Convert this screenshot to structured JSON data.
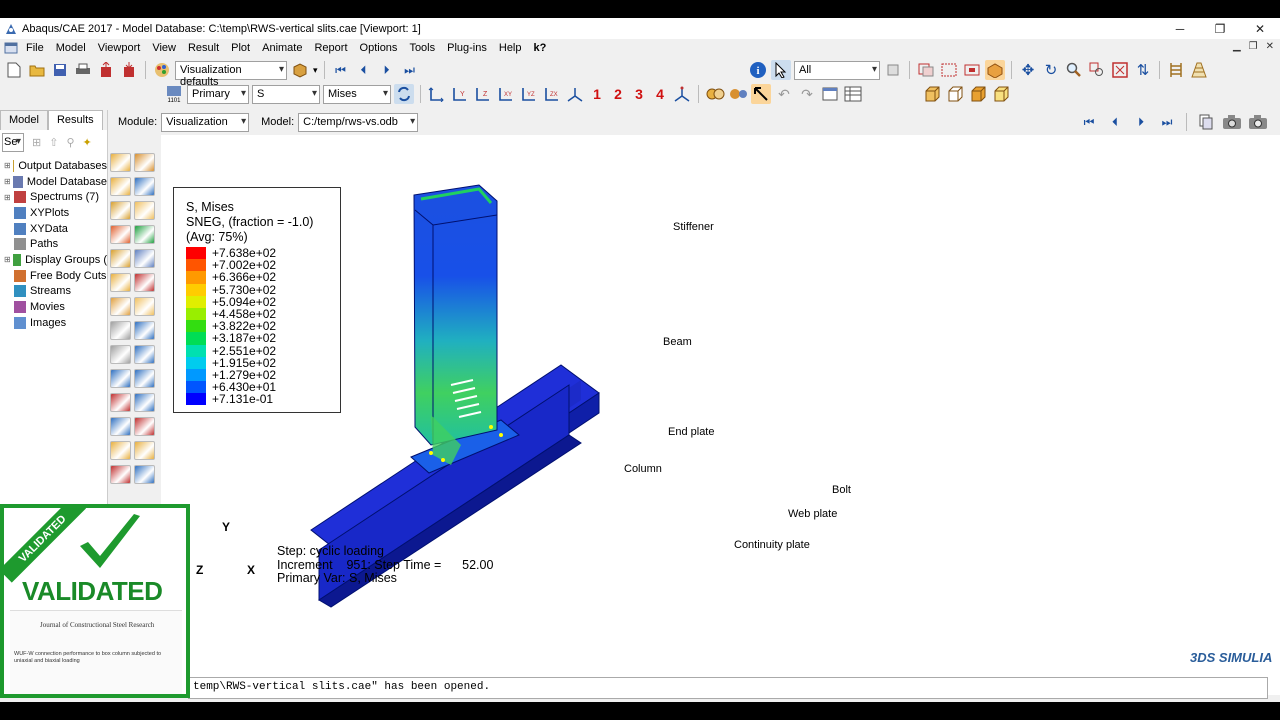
{
  "window": {
    "title": "Abaqus/CAE 2017 - Model Database: C:\\temp\\RWS-vertical slits.cae [Viewport: 1]",
    "controls": [
      "─",
      "❐",
      "✕"
    ]
  },
  "menu": {
    "items": [
      "File",
      "Model",
      "Viewport",
      "View",
      "Result",
      "Plot",
      "Animate",
      "Report",
      "Options",
      "Tools",
      "Plug-ins",
      "Help",
      "k?"
    ]
  },
  "toolbar1": {
    "visualization_defaults": "Visualization defaults",
    "selection_filter": "All"
  },
  "toolbar2": {
    "primary": "Primary",
    "variable": "S",
    "invariant": "Mises",
    "numbers": [
      "1",
      "2",
      "3",
      "4"
    ]
  },
  "module_row": {
    "module_label": "Module:",
    "module_value": "Visualization",
    "model_label": "Model:",
    "model_value": "C:/temp/rws-vs.odb"
  },
  "left_panel": {
    "tabs": [
      "Model",
      "Results"
    ],
    "active_tab": "Results",
    "filter_value": "Se",
    "tree": [
      {
        "label": "Output Databases",
        "expander": "+",
        "color": "#c8a030"
      },
      {
        "label": "Model Database",
        "expander": "+",
        "color": "#6a7ab0"
      },
      {
        "label": "Spectrums (7)",
        "expander": "+",
        "color": "#c04040"
      },
      {
        "label": "XYPlots",
        "expander": "",
        "color": "#5080c0"
      },
      {
        "label": "XYData",
        "expander": "",
        "color": "#5080c0"
      },
      {
        "label": "Paths",
        "expander": "",
        "color": "#909090"
      },
      {
        "label": "Display Groups (",
        "expander": "+",
        "color": "#40a040"
      },
      {
        "label": "Free Body Cuts",
        "expander": "",
        "color": "#d07030"
      },
      {
        "label": "Streams",
        "expander": "",
        "color": "#3090c0"
      },
      {
        "label": "Movies",
        "expander": "",
        "color": "#a050a0"
      },
      {
        "label": "Images",
        "expander": "",
        "color": "#6090d0"
      }
    ]
  },
  "legend": {
    "title_lines": [
      "S, Mises",
      "SNEG, (fraction = -1.0)",
      "(Avg: 75%)"
    ],
    "values": [
      "+7.638e+02",
      "+7.002e+02",
      "+6.366e+02",
      "+5.730e+02",
      "+5.094e+02",
      "+4.458e+02",
      "+3.822e+02",
      "+3.187e+02",
      "+2.551e+02",
      "+1.915e+02",
      "+1.279e+02",
      "+6.430e+01",
      "+7.131e-01"
    ],
    "colors": [
      "#ff0000",
      "#ff5500",
      "#ff9900",
      "#ffcc00",
      "#e0ee00",
      "#99ee00",
      "#33dd11",
      "#00dd55",
      "#00e0b0",
      "#00ccee",
      "#0099ff",
      "#0055ff",
      "#0000ff"
    ]
  },
  "step_info": {
    "line1": "Step: cyclic loading",
    "line2": "Increment    951: Step Time =      52.00",
    "line3": "Primary Var: S, Mises"
  },
  "triad": {
    "y": "Y",
    "z": "Z",
    "x": "X"
  },
  "annotations": {
    "stiffener": "Stiffener",
    "beam": "Beam",
    "end_plate": "End plate",
    "column": "Column",
    "bolt": "Bolt",
    "web_plate": "Web plate",
    "continuity_plate": "Continuity plate"
  },
  "message_area": {
    "text": "temp\\RWS-vertical slits.cae\" has been opened."
  },
  "brand": {
    "simulia": "3DS SIMULIA"
  },
  "badge": {
    "banner": "VALIDATED",
    "text": "VALIDATED",
    "journal": "Journal of Constructional Steel Research",
    "paper_title": "WUF-W connection performance to box column subjected to uniaxial and biaxial loading"
  }
}
